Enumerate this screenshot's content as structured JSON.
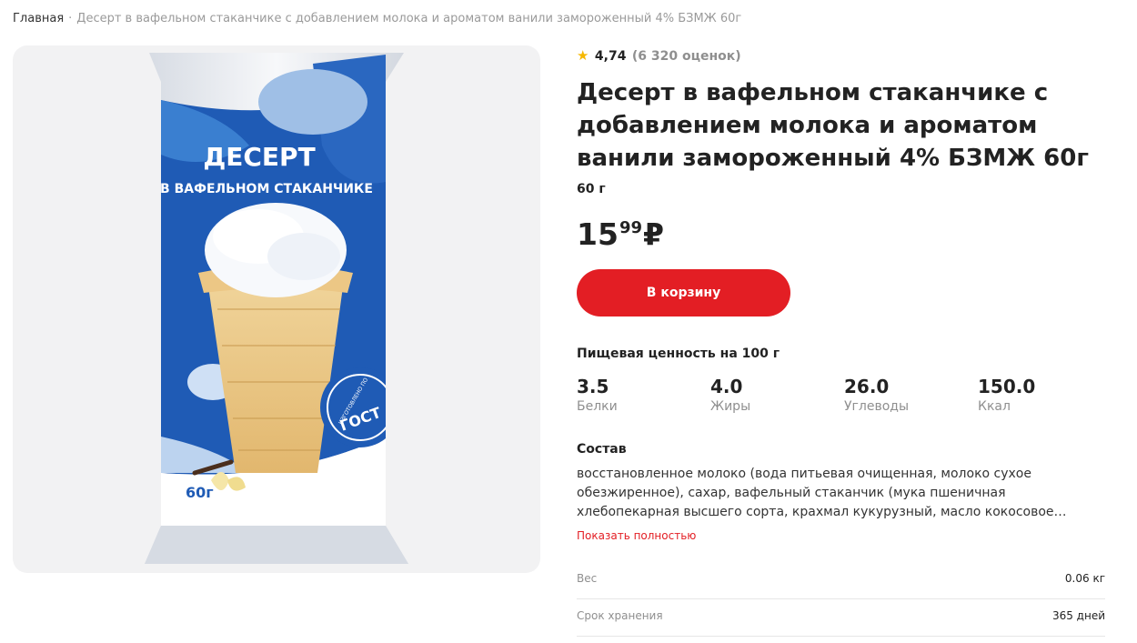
{
  "breadcrumb": {
    "home": "Главная",
    "separator": "·",
    "current": "Десерт в вафельном стаканчике с добавлением молока и ароматом ванили замороженный 4% БЗМЖ 60г"
  },
  "product_image": {
    "headline": "ДЕСЕРТ",
    "subline": "В ВАФЕЛЬНОМ СТАКАНЧИКЕ",
    "stamp_small": "ИЗГОТОВЛЕНО ПО",
    "stamp_big": "ГОСТ",
    "pack_weight": "60г"
  },
  "rating": {
    "icon": "star-icon",
    "score": "4,74",
    "count": "(6 320 оценок)"
  },
  "product": {
    "title_lines": [
      "Десерт в вафельном стаканчике с",
      "добавлением молока и ароматом",
      "ванили замороженный 4% БЗМЖ 60г"
    ],
    "weight": "60 г",
    "price_main": "15",
    "price_kop": "99",
    "currency": "₽",
    "cart_label": "В корзину"
  },
  "nutrition": {
    "title": "Пищевая ценность на 100 г",
    "items": [
      {
        "value": "3.5",
        "label": "Белки"
      },
      {
        "value": "4.0",
        "label": "Жиры"
      },
      {
        "value": "26.0",
        "label": "Углеводы"
      },
      {
        "value": "150.0",
        "label": "Ккал"
      }
    ]
  },
  "composition": {
    "title": "Состав",
    "lines": [
      "восстановленное молоко (вода питьевая очищенная, молоко сухое",
      "обезжиренное), сахар, вафельный стаканчик (мука пшеничная",
      "хлебопекарная высшего сорта, крахмал кукурузный, масло кокосовое…"
    ],
    "show_more": "Показать полностью"
  },
  "specs": [
    {
      "key": "Вес",
      "value": "0.06 кг"
    },
    {
      "key": "Срок хранения",
      "value": "365 дней"
    }
  ],
  "colors": {
    "accent": "#e31e24",
    "star": "#f6b800",
    "pack_blue": "#1f5bb5",
    "muted_text": "#8f8f8f"
  }
}
